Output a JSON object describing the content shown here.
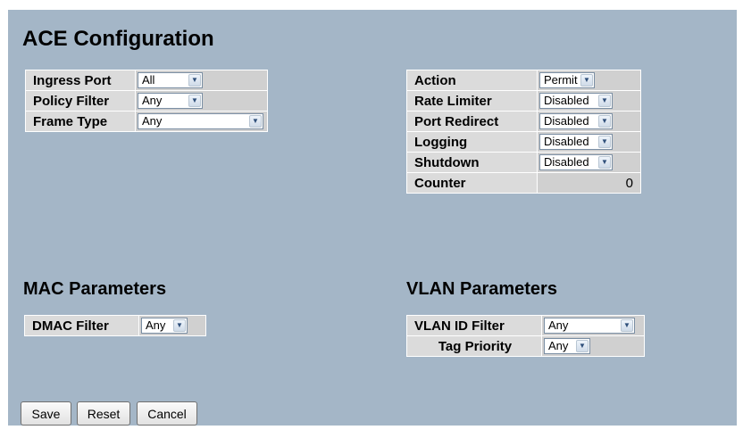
{
  "title": "ACE Configuration",
  "left_table": [
    {
      "label": "Ingress Port",
      "value": "All"
    },
    {
      "label": "Policy Filter",
      "value": "Any"
    },
    {
      "label": "Frame Type",
      "value": "Any"
    }
  ],
  "right_table": [
    {
      "label": "Action",
      "value": "Permit"
    },
    {
      "label": "Rate Limiter",
      "value": "Disabled"
    },
    {
      "label": "Port Redirect",
      "value": "Disabled"
    },
    {
      "label": "Logging",
      "value": "Disabled"
    },
    {
      "label": "Shutdown",
      "value": "Disabled"
    },
    {
      "label": "Counter",
      "value": "0"
    }
  ],
  "mac": {
    "title": "MAC Parameters",
    "rows": [
      {
        "label": "DMAC Filter",
        "value": "Any"
      }
    ]
  },
  "vlan": {
    "title": "VLAN Parameters",
    "rows": [
      {
        "label": "VLAN ID Filter",
        "value": "Any"
      },
      {
        "label": "Tag Priority",
        "value": "Any"
      }
    ]
  },
  "buttons": {
    "save": "Save",
    "reset": "Reset",
    "cancel": "Cancel"
  },
  "colors": {
    "page_bg": "#a4b6c7",
    "label_bg": "#dbdbdb",
    "value_bg": "#d0d0d0"
  },
  "icons": {
    "dropdown": "chevron-down-icon"
  }
}
